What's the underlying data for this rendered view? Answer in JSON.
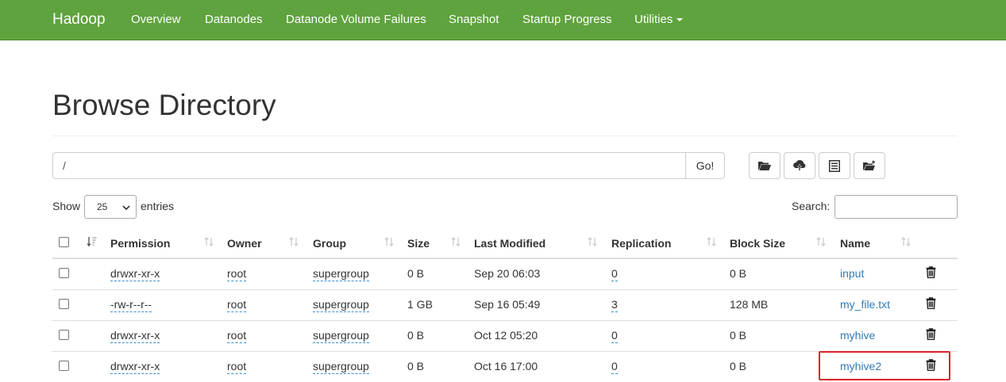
{
  "navbar": {
    "brand": "Hadoop",
    "items": [
      {
        "label": "Overview"
      },
      {
        "label": "Datanodes"
      },
      {
        "label": "Datanode Volume Failures"
      },
      {
        "label": "Snapshot"
      },
      {
        "label": "Startup Progress"
      },
      {
        "label": "Utilities"
      }
    ]
  },
  "page": {
    "title": "Browse Directory"
  },
  "path": {
    "value": "/",
    "go_label": "Go!"
  },
  "toolbar": {
    "icons": [
      "folder-open-icon",
      "cloud-upload-icon",
      "list-icon",
      "create-folder-icon"
    ]
  },
  "table_controls": {
    "show_label": "Show",
    "entries_value": "25",
    "entries_label": "entries",
    "search_label": "Search:"
  },
  "table": {
    "columns": [
      "Permission",
      "Owner",
      "Group",
      "Size",
      "Last Modified",
      "Replication",
      "Block Size",
      "Name"
    ],
    "rows": [
      {
        "permission": "drwxr-xr-x",
        "owner": "root",
        "group": "supergroup",
        "size": "0 B",
        "modified": "Sep 20 06:03",
        "replication": "0",
        "block_size": "0 B",
        "name": "input"
      },
      {
        "permission": "-rw-r--r--",
        "owner": "root",
        "group": "supergroup",
        "size": "1 GB",
        "modified": "Sep 16 05:49",
        "replication": "3",
        "block_size": "128 MB",
        "name": "my_file.txt"
      },
      {
        "permission": "drwxr-xr-x",
        "owner": "root",
        "group": "supergroup",
        "size": "0 B",
        "modified": "Oct 12 05:20",
        "replication": "0",
        "block_size": "0 B",
        "name": "myhive"
      },
      {
        "permission": "drwxr-xr-x",
        "owner": "root",
        "group": "supergroup",
        "size": "0 B",
        "modified": "Oct 16 17:00",
        "replication": "0",
        "block_size": "0 B",
        "name": "myhive2"
      }
    ]
  },
  "colors": {
    "navbar": "#5fa33e",
    "link": "#337ab7",
    "highlight": "#d9232d"
  }
}
